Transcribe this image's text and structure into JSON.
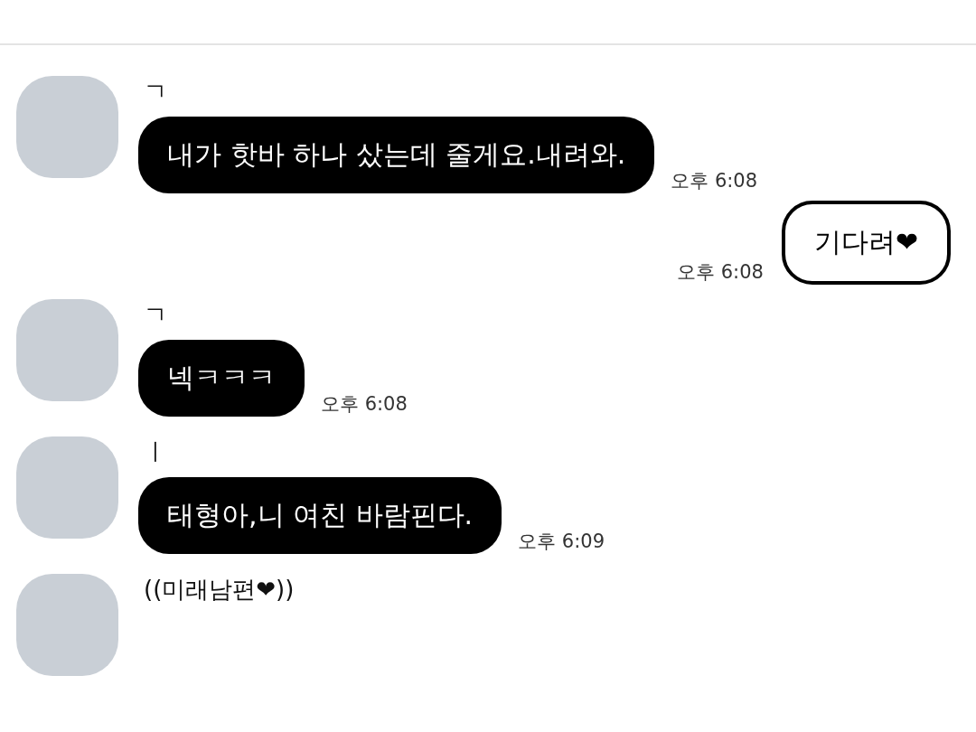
{
  "messages": [
    {
      "kind": "incoming",
      "sender": "ㄱ",
      "text": "내가 핫바 하나 샀는데 줄게요.내려와.",
      "time": "오후 6:08"
    },
    {
      "kind": "outgoing",
      "text": "기다려❤",
      "time": "오후 6:08"
    },
    {
      "kind": "incoming",
      "sender": "ㄱ",
      "text": "넥ㅋㅋㅋ",
      "time": "오후 6:08"
    },
    {
      "kind": "incoming",
      "sender": "ㅣ",
      "text": "태형아,니 여친 바람핀다.",
      "time": "오후 6:09"
    },
    {
      "kind": "incoming",
      "sender": "((미래남편❤))"
    }
  ]
}
